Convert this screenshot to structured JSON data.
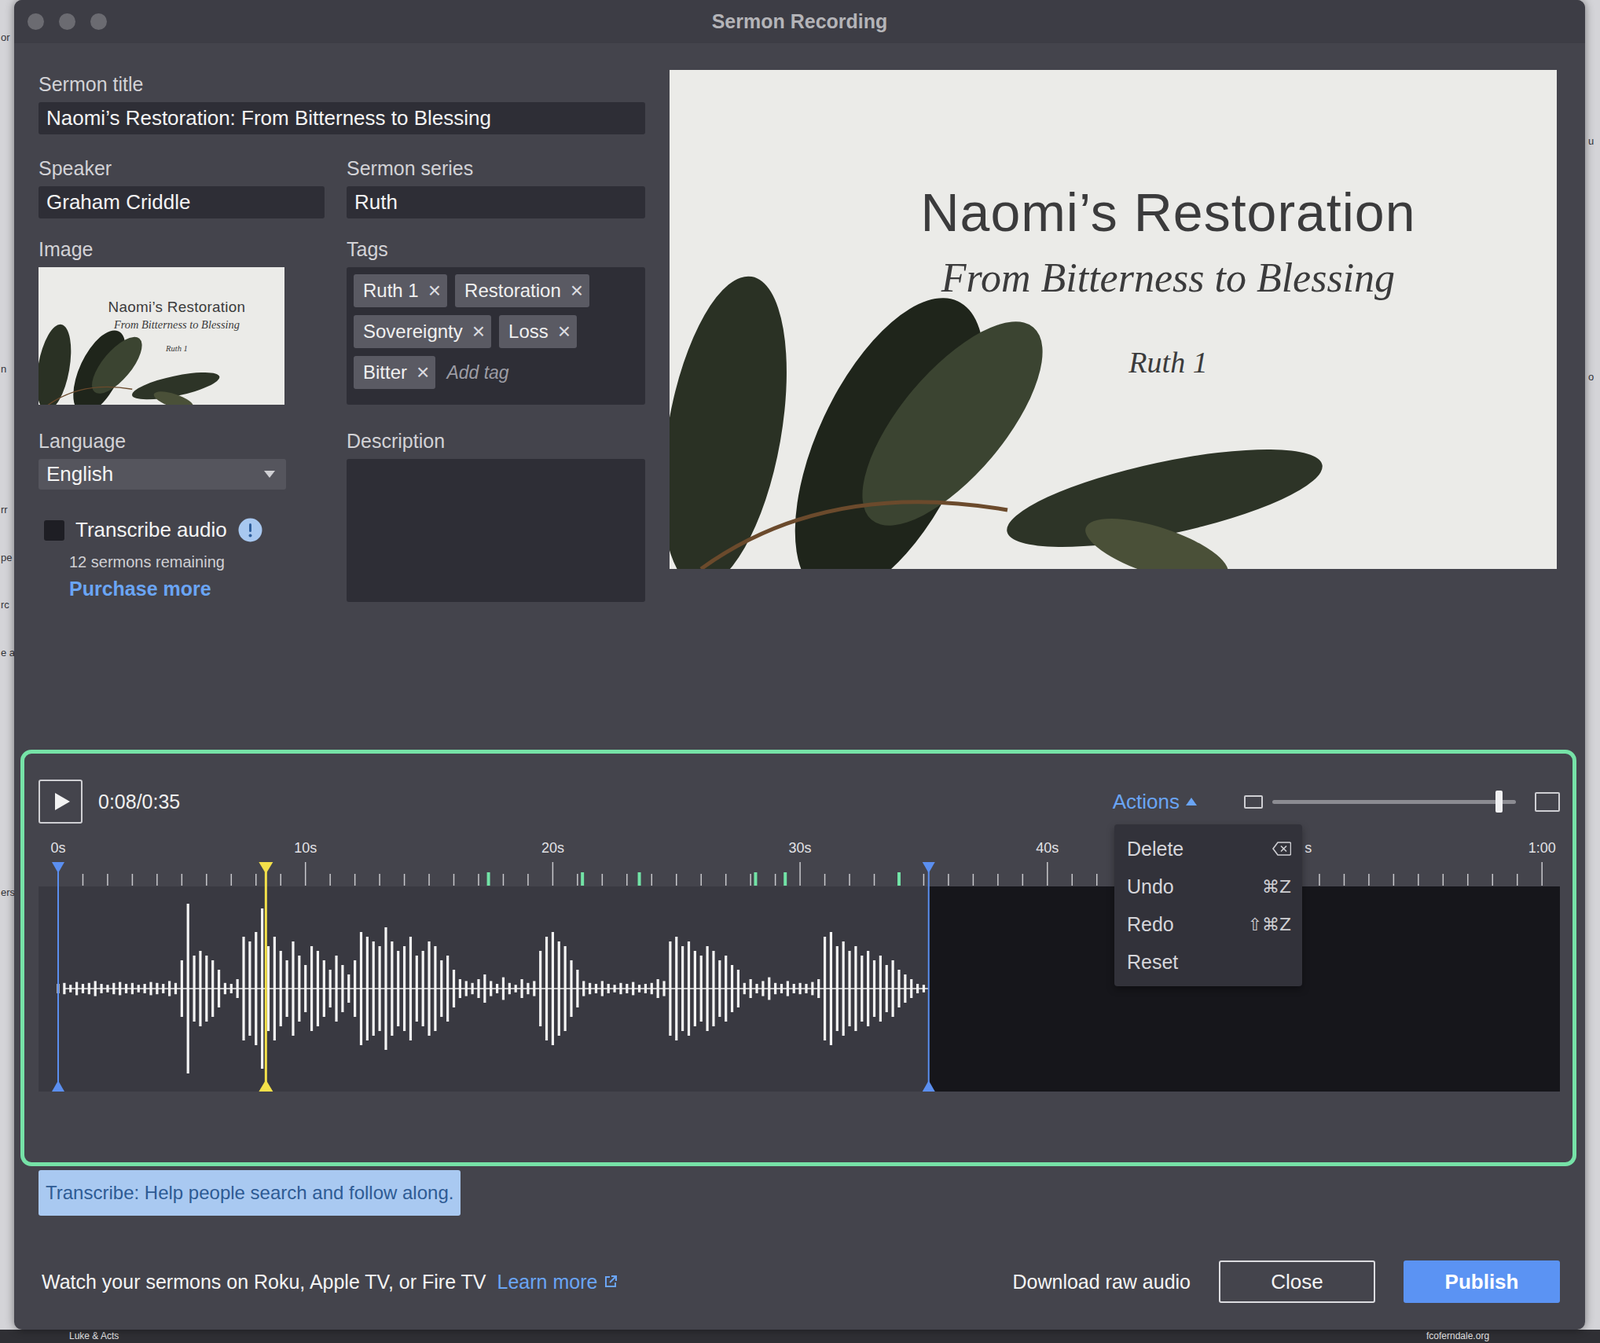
{
  "window": {
    "title": "Sermon Recording"
  },
  "backdrop": {
    "left": [
      "or",
      "n",
      "rr",
      "pe",
      "rc",
      "e a",
      "ers"
    ],
    "right": [
      "u",
      "o"
    ],
    "bottom": [
      "Luke & Acts",
      "fcoferndale.org"
    ]
  },
  "form": {
    "title": {
      "label": "Sermon title",
      "value": "Naomi’s Restoration: From Bitterness to Blessing"
    },
    "speaker": {
      "label": "Speaker",
      "value": "Graham Criddle"
    },
    "series": {
      "label": "Sermon series",
      "value": "Ruth"
    },
    "image": {
      "label": "Image"
    },
    "tags": {
      "label": "Tags",
      "items": [
        {
          "text": "Ruth 1",
          "remove": "×"
        },
        {
          "text": "Restoration",
          "remove": "×"
        },
        {
          "text": "Sovereignty",
          "remove": "×"
        },
        {
          "text": "Loss",
          "remove": "×"
        },
        {
          "text": "Bitter",
          "remove": "×"
        }
      ],
      "placeholder": "Add tag"
    },
    "language": {
      "label": "Language",
      "value": "English"
    },
    "transcribe": {
      "label": "Transcribe audio",
      "checked": false,
      "remaining": "12 sermons remaining",
      "link": "Purchase more"
    },
    "description": {
      "label": "Description"
    }
  },
  "slide": {
    "title": "Naomi’s Restoration",
    "subtitle": "From Bitterness to Blessing",
    "reference": "Ruth 1"
  },
  "player": {
    "time": "0:08/0:35",
    "playhead": 8.4,
    "start": 0,
    "end": 35.2,
    "actions": {
      "label": "Actions",
      "expanded": true,
      "items": [
        {
          "label": "Delete",
          "kind": "icon",
          "shortcut": ""
        },
        {
          "label": "Undo",
          "kind": "keys",
          "shortcut": "⌘Z"
        },
        {
          "label": "Redo",
          "kind": "keys",
          "shortcut": "⇧⌘Z"
        },
        {
          "label": "Reset",
          "kind": "plain",
          "shortcut": ""
        }
      ]
    },
    "zoom": {
      "level": 0.93
    },
    "ruler": {
      "labels": [
        {
          "text": "0s",
          "t": 0
        },
        {
          "text": "10s",
          "t": 10
        },
        {
          "text": "20s",
          "t": 20
        },
        {
          "text": "30s",
          "t": 30
        },
        {
          "text": "40s",
          "t": 40
        },
        {
          "text": "s",
          "t": 50.55
        },
        {
          "text": "1:00",
          "t": 60
        }
      ],
      "minor_every": 1,
      "length": 60
    },
    "markers": [
      17.4,
      21.2,
      23.5,
      28.2,
      29.4,
      34.0
    ],
    "waveform": {
      "step": 0.25,
      "values": [
        0.05,
        0.06,
        0.04,
        0.07,
        0.05,
        0.06,
        0.08,
        0.05,
        0.04,
        0.06,
        0.07,
        0.05,
        0.06,
        0.04,
        0.05,
        0.07,
        0.06,
        0.05,
        0.08,
        0.06,
        0.3,
        0.9,
        0.35,
        0.4,
        0.35,
        0.3,
        0.2,
        0.06,
        0.05,
        0.1,
        0.55,
        0.5,
        0.6,
        0.85,
        0.45,
        0.55,
        0.4,
        0.3,
        0.5,
        0.35,
        0.25,
        0.45,
        0.4,
        0.3,
        0.2,
        0.35,
        0.25,
        0.15,
        0.3,
        0.6,
        0.55,
        0.5,
        0.45,
        0.65,
        0.5,
        0.4,
        0.45,
        0.55,
        0.35,
        0.4,
        0.5,
        0.45,
        0.3,
        0.35,
        0.2,
        0.1,
        0.08,
        0.06,
        0.1,
        0.15,
        0.08,
        0.05,
        0.12,
        0.06,
        0.04,
        0.1,
        0.06,
        0.08,
        0.4,
        0.55,
        0.6,
        0.5,
        0.45,
        0.3,
        0.2,
        0.08,
        0.06,
        0.05,
        0.08,
        0.05,
        0.04,
        0.06,
        0.05,
        0.07,
        0.04,
        0.05,
        0.06,
        0.1,
        0.08,
        0.5,
        0.55,
        0.45,
        0.5,
        0.4,
        0.35,
        0.45,
        0.4,
        0.3,
        0.35,
        0.25,
        0.2,
        0.06,
        0.1,
        0.05,
        0.08,
        0.12,
        0.06,
        0.05,
        0.08,
        0.05,
        0.06,
        0.05,
        0.07,
        0.1,
        0.55,
        0.6,
        0.45,
        0.5,
        0.4,
        0.45,
        0.35,
        0.4,
        0.3,
        0.35,
        0.25,
        0.3,
        0.2,
        0.15,
        0.1,
        0.05,
        0.04
      ]
    }
  },
  "hint": "Transcribe: Help people search and follow along.",
  "footer": {
    "promo": "Watch your sermons on Roku, Apple TV, or Fire TV",
    "learn_more": "Learn more",
    "download": "Download raw audio",
    "close": "Close",
    "publish": "Publish"
  }
}
